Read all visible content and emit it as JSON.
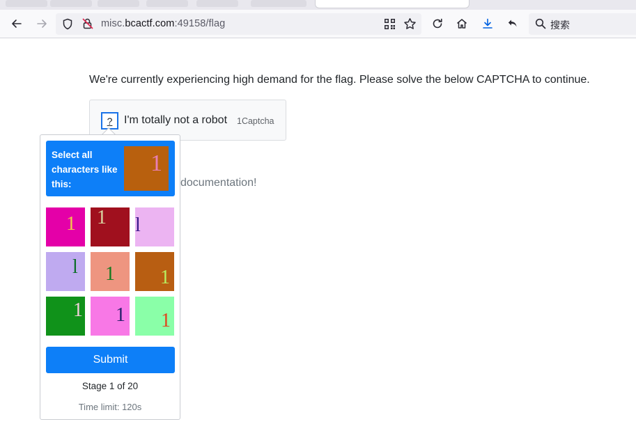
{
  "browser": {
    "url_prefix": "misc.",
    "url_host": "bcactf.com",
    "url_suffix": ":49158/flag",
    "search_placeholder": "搜索"
  },
  "page": {
    "message": "We're currently experiencing high demand for the flag. Please solve the below CAPTCHA to continue.",
    "partial_text": "documentation!"
  },
  "captcha": {
    "checkbox_glyph": "?",
    "label": "I'm totally not a robot",
    "brand": "1Captcha"
  },
  "popup": {
    "prompt": "Select all characters like this:",
    "target": {
      "char": "1",
      "bg": "#b8600e",
      "fg": "#e87fb5"
    },
    "tiles": [
      {
        "char": "1",
        "bg": "#e400a8",
        "fg": "#f2c94c"
      },
      {
        "char": "1",
        "bg": "#a0101e",
        "fg": "#d9d2a0"
      },
      {
        "char": "l",
        "bg": "#ecb4f2",
        "fg": "#3a1a8a"
      },
      {
        "char": "l",
        "bg": "#bfaaf0",
        "fg": "#0d6e2a"
      },
      {
        "char": "1",
        "bg": "#ee9580",
        "fg": "#137a1f"
      },
      {
        "char": "1",
        "bg": "#b85e12",
        "fg": "#b8f060"
      },
      {
        "char": "1",
        "bg": "#10921a",
        "fg": "#f0d0d8"
      },
      {
        "char": "1",
        "bg": "#f878e6",
        "fg": "#26206a"
      },
      {
        "char": "1",
        "bg": "#8affa8",
        "fg": "#e0441c"
      }
    ],
    "submit_label": "Submit",
    "stage": "Stage 1 of 20",
    "time_limit": "Time limit: 120s"
  }
}
